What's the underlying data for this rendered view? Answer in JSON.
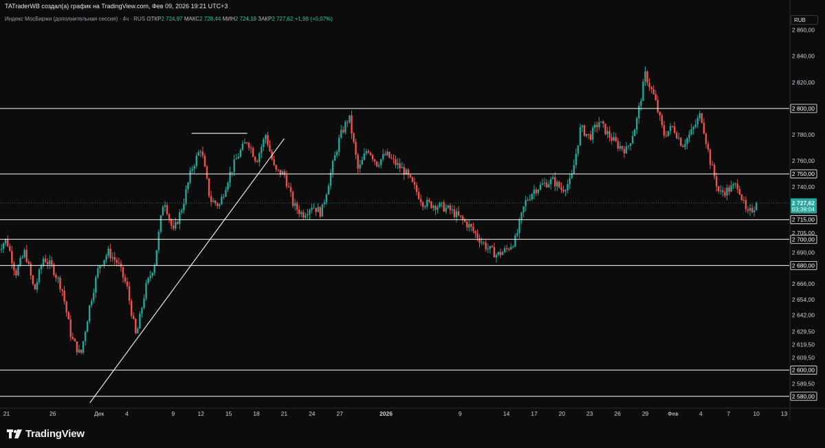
{
  "author_line": "TATraderWB создал(а) график на TradingView.com, Фев 09, 2026 19:21 UTC+3",
  "legend": {
    "symbol": "Индекс МосБиржи (дополнительная сессия) · 4ч · RUS",
    "open_label": "ОТКР",
    "open": "2 724,97",
    "high_label": "МАКС",
    "high": "2 728,44",
    "low_label": "МИН",
    "low": "2 724,19",
    "close_label": "ЗАКР",
    "close": "2 727,62",
    "change": "+1,98 (+0,07%)"
  },
  "currency": "RUB",
  "brand": "TradingView",
  "colors": {
    "up": "#26a69a",
    "down": "#ef5350",
    "background": "#0c0c0c",
    "line": "#ffffff",
    "last_price": "#26a69a"
  },
  "chart_data": {
    "type": "candlestick",
    "timeframe": "4ч",
    "ylim": [
      2572,
      2864
    ],
    "price_ticks": [
      {
        "v": 2860,
        "t": "2 860,00"
      },
      {
        "v": 2840,
        "t": "2 840,00"
      },
      {
        "v": 2820,
        "t": "2 820,00"
      },
      {
        "v": 2780,
        "t": "2 780,00"
      },
      {
        "v": 2760,
        "t": "2 760,00"
      },
      {
        "v": 2740,
        "t": "2 740,00"
      },
      {
        "v": 2705,
        "t": "2 705,00"
      },
      {
        "v": 2690,
        "t": "2 690,00"
      },
      {
        "v": 2666,
        "t": "2 666,00"
      },
      {
        "v": 2654,
        "t": "2 654,00"
      },
      {
        "v": 2642,
        "t": "2 642,00"
      },
      {
        "v": 2629.5,
        "t": "2 629,50"
      },
      {
        "v": 2619.5,
        "t": "2 619,50"
      },
      {
        "v": 2609.5,
        "t": "2 609,50"
      },
      {
        "v": 2589.5,
        "t": "2 589,50"
      }
    ],
    "date_ticks": [
      {
        "d": "2025-11-21",
        "t": "21",
        "b": false
      },
      {
        "d": "2025-11-26",
        "t": "26",
        "b": false
      },
      {
        "d": "2025-12-01",
        "t": "Дек",
        "b": false
      },
      {
        "d": "2025-12-04",
        "t": "4",
        "b": false
      },
      {
        "d": "2025-12-09",
        "t": "9",
        "b": false
      },
      {
        "d": "2025-12-12",
        "t": "12",
        "b": false
      },
      {
        "d": "2025-12-15",
        "t": "15",
        "b": false
      },
      {
        "d": "2025-12-18",
        "t": "18",
        "b": false
      },
      {
        "d": "2025-12-21",
        "t": "21",
        "b": false
      },
      {
        "d": "2025-12-24",
        "t": "24",
        "b": false
      },
      {
        "d": "2025-12-27",
        "t": "27",
        "b": false
      },
      {
        "d": "2026-01-01",
        "t": "2026",
        "b": true
      },
      {
        "d": "2026-01-09",
        "t": "9",
        "b": false
      },
      {
        "d": "2026-01-14",
        "t": "14",
        "b": false
      },
      {
        "d": "2026-01-17",
        "t": "17",
        "b": false
      },
      {
        "d": "2026-01-20",
        "t": "20",
        "b": false
      },
      {
        "d": "2026-01-23",
        "t": "23",
        "b": false
      },
      {
        "d": "2026-01-26",
        "t": "26",
        "b": false
      },
      {
        "d": "2026-01-29",
        "t": "29",
        "b": false
      },
      {
        "d": "2026-02-01",
        "t": "Фев",
        "b": false
      },
      {
        "d": "2026-02-04",
        "t": "4",
        "b": false
      },
      {
        "d": "2026-02-07",
        "t": "7",
        "b": false
      },
      {
        "d": "2026-02-10",
        "t": "10",
        "b": false
      },
      {
        "d": "2026-02-13",
        "t": "13",
        "b": false
      }
    ],
    "horizontal_levels": [
      {
        "v": 2800,
        "t": "2 800,00"
      },
      {
        "v": 2750,
        "t": "2 750,00"
      },
      {
        "v": 2715,
        "t": "2 715,00"
      },
      {
        "v": 2700,
        "t": "2 700,00"
      },
      {
        "v": 2680,
        "t": "2 680,00"
      },
      {
        "v": 2600,
        "t": "2 600,00"
      },
      {
        "v": 2580,
        "t": "2 580,00"
      }
    ],
    "last_price": {
      "v": 2727.62,
      "t": "2 727,62",
      "countdown": "03:38:04"
    },
    "trendline": {
      "from": {
        "d": "2025-11-30",
        "v": 2575
      },
      "to": {
        "d": "2025-12-21",
        "v": 2777
      }
    },
    "short_level": {
      "from": {
        "d": "2025-12-11",
        "v": 2781
      },
      "to": {
        "d": "2025-12-17",
        "v": 2781
      }
    },
    "price_path": [
      {
        "d": "2025-11-20",
        "v": 2692
      },
      {
        "d": "2025-11-21",
        "v": 2700
      },
      {
        "d": "2025-11-22",
        "v": 2674
      },
      {
        "d": "2025-11-23",
        "v": 2691
      },
      {
        "d": "2025-11-24",
        "v": 2660
      },
      {
        "d": "2025-11-25",
        "v": 2686
      },
      {
        "d": "2025-11-26",
        "v": 2678
      },
      {
        "d": "2025-11-27",
        "v": 2662
      },
      {
        "d": "2025-11-28",
        "v": 2625
      },
      {
        "d": "2025-11-29",
        "v": 2611
      },
      {
        "d": "2025-11-30",
        "v": 2650
      },
      {
        "d": "2025-12-01",
        "v": 2680
      },
      {
        "d": "2025-12-02",
        "v": 2690
      },
      {
        "d": "2025-12-03",
        "v": 2682
      },
      {
        "d": "2025-12-04",
        "v": 2664
      },
      {
        "d": "2025-12-05",
        "v": 2625
      },
      {
        "d": "2025-12-06",
        "v": 2662
      },
      {
        "d": "2025-12-07",
        "v": 2682
      },
      {
        "d": "2025-12-08",
        "v": 2732
      },
      {
        "d": "2025-12-09",
        "v": 2705
      },
      {
        "d": "2025-12-10",
        "v": 2725
      },
      {
        "d": "2025-12-11",
        "v": 2754
      },
      {
        "d": "2025-12-12",
        "v": 2770
      },
      {
        "d": "2025-12-13",
        "v": 2730
      },
      {
        "d": "2025-12-14",
        "v": 2726
      },
      {
        "d": "2025-12-15",
        "v": 2748
      },
      {
        "d": "2025-12-16",
        "v": 2764
      },
      {
        "d": "2025-12-17",
        "v": 2776
      },
      {
        "d": "2025-12-18",
        "v": 2760
      },
      {
        "d": "2025-12-19",
        "v": 2780
      },
      {
        "d": "2025-12-20",
        "v": 2752
      },
      {
        "d": "2025-12-21",
        "v": 2750
      },
      {
        "d": "2025-12-22",
        "v": 2726
      },
      {
        "d": "2025-12-23",
        "v": 2719
      },
      {
        "d": "2025-12-24",
        "v": 2726
      },
      {
        "d": "2025-12-25",
        "v": 2720
      },
      {
        "d": "2025-12-26",
        "v": 2750
      },
      {
        "d": "2025-12-27",
        "v": 2778
      },
      {
        "d": "2025-12-28",
        "v": 2794
      },
      {
        "d": "2025-12-29",
        "v": 2752
      },
      {
        "d": "2025-12-30",
        "v": 2770
      },
      {
        "d": "2025-12-31",
        "v": 2758
      },
      {
        "d": "2026-01-01",
        "v": 2765
      },
      {
        "d": "2026-01-02",
        "v": 2758
      },
      {
        "d": "2026-01-03",
        "v": 2752
      },
      {
        "d": "2026-01-05",
        "v": 2728
      },
      {
        "d": "2026-01-07",
        "v": 2725
      },
      {
        "d": "2026-01-08",
        "v": 2722
      },
      {
        "d": "2026-01-10",
        "v": 2710
      },
      {
        "d": "2026-01-11",
        "v": 2701
      },
      {
        "d": "2026-01-12",
        "v": 2693
      },
      {
        "d": "2026-01-13",
        "v": 2688
      },
      {
        "d": "2026-01-14",
        "v": 2692
      },
      {
        "d": "2026-01-15",
        "v": 2700
      },
      {
        "d": "2026-01-16",
        "v": 2728
      },
      {
        "d": "2026-01-17",
        "v": 2738
      },
      {
        "d": "2026-01-18",
        "v": 2742
      },
      {
        "d": "2026-01-19",
        "v": 2745
      },
      {
        "d": "2026-01-20",
        "v": 2738
      },
      {
        "d": "2026-01-21",
        "v": 2745
      },
      {
        "d": "2026-01-22",
        "v": 2785
      },
      {
        "d": "2026-01-23",
        "v": 2778
      },
      {
        "d": "2026-01-24",
        "v": 2790
      },
      {
        "d": "2026-01-25",
        "v": 2780
      },
      {
        "d": "2026-01-26",
        "v": 2772
      },
      {
        "d": "2026-01-27",
        "v": 2768
      },
      {
        "d": "2026-01-28",
        "v": 2788
      },
      {
        "d": "2026-01-29",
        "v": 2826
      },
      {
        "d": "2026-01-30",
        "v": 2808
      },
      {
        "d": "2026-01-31",
        "v": 2780
      },
      {
        "d": "2026-02-01",
        "v": 2786
      },
      {
        "d": "2026-02-02",
        "v": 2772
      },
      {
        "d": "2026-02-03",
        "v": 2782
      },
      {
        "d": "2026-02-04",
        "v": 2796
      },
      {
        "d": "2026-02-05",
        "v": 2760
      },
      {
        "d": "2026-02-06",
        "v": 2735
      },
      {
        "d": "2026-02-07",
        "v": 2738
      },
      {
        "d": "2026-02-08",
        "v": 2742
      },
      {
        "d": "2026-02-09",
        "v": 2718
      },
      {
        "d": "2026-02-10",
        "v": 2727
      }
    ]
  }
}
